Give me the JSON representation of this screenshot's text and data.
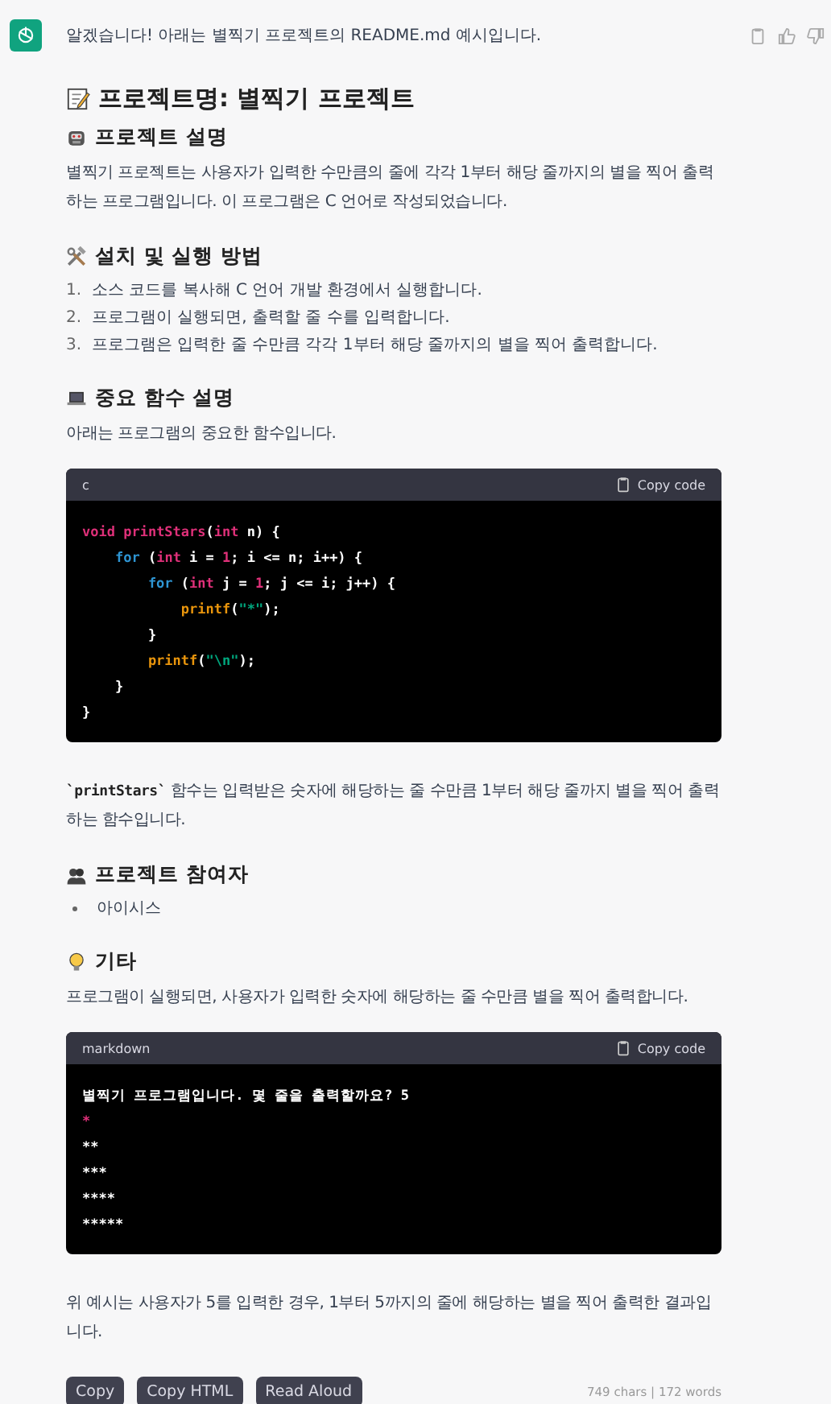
{
  "message": {
    "intro": "알겠습니다! 아래는 별찍기 프로젝트의 README.md 예시입니다.",
    "blocks": [
      {
        "kind": "h1",
        "text": "프로젝트명: 별찍기 프로젝트"
      },
      {
        "kind": "h2",
        "text": "프로젝트 설명"
      },
      {
        "kind": "paragraph",
        "text": "별찍기 프로젝트는 사용자가 입력한 수만큼의 줄에 각각 1부터 해당 줄까지의 별을 찍어 출력하는 프로그램입니다. 이 프로그램은 C 언어로 작성되었습니다."
      },
      {
        "kind": "h2",
        "text": "설치 및 실행 방법"
      },
      {
        "kind": "ordered_list",
        "items": [
          {
            "number": "1.",
            "text": "소스 코드를 복사해 C 언어 개발 환경에서 실행합니다."
          },
          {
            "number": "2.",
            "text": "프로그램이 실행되면, 출력할 줄 수를 입력합니다."
          },
          {
            "number": "3.",
            "text": "프로그램은 입력한 줄 수만큼 각각 1부터 해당 줄까지의 별을 찍어 출력합니다."
          }
        ]
      },
      {
        "kind": "h2",
        "text": "중요 함수 설명"
      },
      {
        "kind": "paragraph",
        "text": "아래는 프로그램의 중요한 함수입니다."
      },
      {
        "kind": "code",
        "language": "c",
        "copy_label": "Copy code",
        "lines": [
          [
            {
              "kind": "keyword",
              "text": "void "
            },
            {
              "kind": "function",
              "text": "printStars"
            },
            {
              "kind": "plain",
              "text": "("
            },
            {
              "kind": "keyword",
              "text": "int"
            },
            {
              "kind": "plain",
              "text": " n) {"
            }
          ],
          [
            {
              "kind": "control",
              "text": "    for"
            },
            {
              "kind": "plain",
              "text": " ("
            },
            {
              "kind": "keyword",
              "text": "int"
            },
            {
              "kind": "plain",
              "text": " i = "
            },
            {
              "kind": "number",
              "text": "1"
            },
            {
              "kind": "plain",
              "text": "; i <= n; i++) {"
            }
          ],
          [
            {
              "kind": "control",
              "text": "        for"
            },
            {
              "kind": "plain",
              "text": " ("
            },
            {
              "kind": "keyword",
              "text": "int"
            },
            {
              "kind": "plain",
              "text": " j = "
            },
            {
              "kind": "number",
              "text": "1"
            },
            {
              "kind": "plain",
              "text": "; j <= i; j++) {"
            }
          ],
          [
            {
              "kind": "builtin",
              "text": "            printf"
            },
            {
              "kind": "plain",
              "text": "("
            },
            {
              "kind": "string",
              "text": "\"*\""
            },
            {
              "kind": "plain",
              "text": ");"
            }
          ],
          [
            {
              "kind": "plain",
              "text": "        }"
            }
          ],
          [
            {
              "kind": "builtin",
              "text": "        printf"
            },
            {
              "kind": "plain",
              "text": "("
            },
            {
              "kind": "string",
              "text": "\"\\n\""
            },
            {
              "kind": "plain",
              "text": ");"
            }
          ],
          [
            {
              "kind": "plain",
              "text": "    }"
            }
          ],
          [
            {
              "kind": "plain",
              "text": "}"
            }
          ]
        ]
      },
      {
        "kind": "paragraph",
        "code": "`printStars`",
        "text": " 함수는 입력받은 숫자에 해당하는 줄 수만큼 1부터 해당 줄까지 별을 찍어 출력하는 함수입니다."
      },
      {
        "kind": "h2",
        "text": "프로젝트 참여자"
      },
      {
        "kind": "bullet_list",
        "items": [
          {
            "text": "아이시스"
          }
        ]
      },
      {
        "kind": "h2",
        "text": "기타"
      },
      {
        "kind": "paragraph",
        "text": "프로그램이 실행되면, 사용자가 입력한 숫자에 해당하는 줄 수만큼 별을 찍어 출력합니다."
      },
      {
        "kind": "code",
        "language": "markdown",
        "copy_label": "Copy code",
        "lines": [
          [
            {
              "kind": "plain",
              "text": "별찍기 프로그램입니다. 몇 줄을 출력할까요? 5"
            }
          ],
          [
            {
              "kind": "keyword",
              "text": "*"
            }
          ],
          [
            {
              "kind": "plain",
              "text": "**"
            }
          ],
          [
            {
              "kind": "plain",
              "text": "***"
            }
          ],
          [
            {
              "kind": "plain",
              "text": "****"
            }
          ],
          [
            {
              "kind": "plain",
              "text": "*****"
            }
          ]
        ]
      },
      {
        "kind": "paragraph",
        "text": "위 예시는 사용자가 5를 입력한 경우, 1부터 5까지의 줄에 해당하는 별을 찍어 출력한 결과입니다."
      }
    ],
    "buttons": [
      "Copy",
      "Copy HTML",
      "Read Aloud"
    ],
    "stats": "749 chars | 172 words"
  }
}
